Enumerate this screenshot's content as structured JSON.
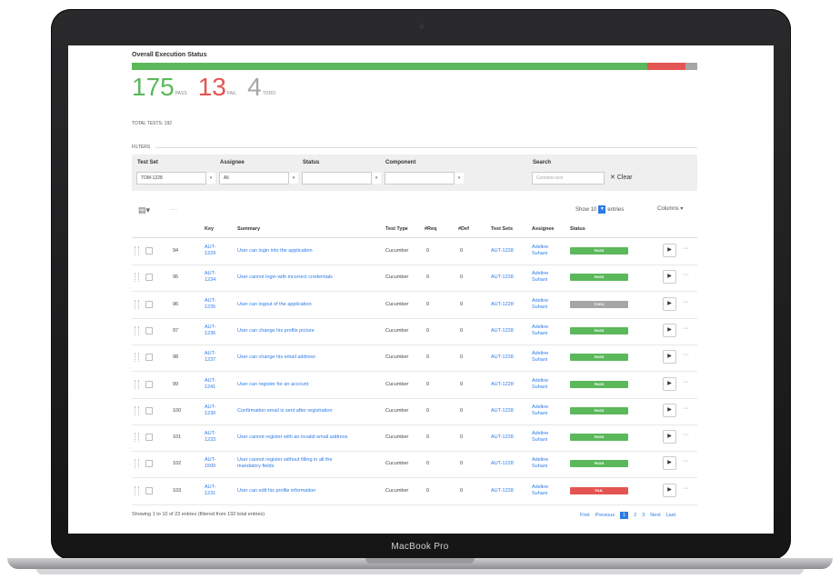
{
  "device": {
    "brand": "MacBook Pro"
  },
  "colors": {
    "pass": "#5bb85b",
    "fail": "#e35552",
    "todo": "#a6a6a6",
    "link": "#2d7be5"
  },
  "execution": {
    "title": "Overall Execution Status",
    "progress": {
      "pass": 175,
      "fail": 13,
      "todo": 4
    },
    "pass_count": "175",
    "pass_label": "PASS",
    "fail_count": "13",
    "fail_label": "FAIL",
    "todo_count": "4",
    "todo_label": "TODO",
    "total": "TOTAL TESTS: 192"
  },
  "filters": {
    "label": "FILTERS",
    "test_set": {
      "label": "Test Set",
      "value": "TOM-1228"
    },
    "assignee": {
      "label": "Assignee",
      "value": "All"
    },
    "status": {
      "label": "Status",
      "value": ""
    },
    "component": {
      "label": "Component",
      "value": ""
    },
    "search": {
      "label": "Search",
      "placeholder": "Contains text"
    },
    "clear_label": "✕ Clear"
  },
  "toolbar": {
    "show_label": "Show",
    "show_value": "10",
    "entries_label": "entries",
    "columns_label": "Columns ▾"
  },
  "table": {
    "headers": [
      "Key",
      "Summary",
      "Test Type",
      "#Req",
      "#Def",
      "Test Sets",
      "Assignee",
      "Status"
    ],
    "rows": [
      {
        "num": "94",
        "key1": "AUT-",
        "key2": "1229",
        "summary1": "User can login into the application",
        "summary2": "",
        "type": "Cucumber",
        "req": "0",
        "def": "0",
        "set": "AUT-1228",
        "a1": "Adeline",
        "a2": "Suhani",
        "status": "PASS"
      },
      {
        "num": "95",
        "key1": "AUT-",
        "key2": "1234",
        "summary1": "User cannot login with incorrect credentials",
        "summary2": "",
        "type": "Cucumber",
        "req": "0",
        "def": "0",
        "set": "AUT-1228",
        "a1": "Adeline",
        "a2": "Suhani",
        "status": "PASS"
      },
      {
        "num": "96",
        "key1": "AUT-",
        "key2": "1235",
        "summary1": "User can logout of the application",
        "summary2": "",
        "type": "Cucumber",
        "req": "0",
        "def": "0",
        "set": "AUT-1228",
        "a1": "Adeline",
        "a2": "Suhani",
        "status": "TODO"
      },
      {
        "num": "97",
        "key1": "AUT-",
        "key2": "1236",
        "summary1": "User can change his profile picture",
        "summary2": "",
        "type": "Cucumber",
        "req": "0",
        "def": "0",
        "set": "AUT-1228",
        "a1": "Adeline",
        "a2": "Suhani",
        "status": "PASS"
      },
      {
        "num": "98",
        "key1": "AUT-",
        "key2": "1237",
        "summary1": "User can change his email address",
        "summary2": "",
        "type": "Cucumber",
        "req": "0",
        "def": "0",
        "set": "AUT-1228",
        "a1": "Adeline",
        "a2": "Suhani",
        "status": "PASS"
      },
      {
        "num": "99",
        "key1": "AUT-",
        "key2": "1241",
        "summary1": "User can register for an account",
        "summary2": "",
        "type": "Cucumber",
        "req": "0",
        "def": "0",
        "set": "AUT-1228",
        "a1": "Adeline",
        "a2": "Suhani",
        "status": "PASS"
      },
      {
        "num": "100",
        "key1": "AUT-",
        "key2": "1230",
        "summary1": "Confirmation email is sent after registration",
        "summary2": "",
        "type": "Cucumber",
        "req": "0",
        "def": "0",
        "set": "AUT-1228",
        "a1": "Adeline",
        "a2": "Suhani",
        "status": "PASS"
      },
      {
        "num": "101",
        "key1": "AUT-",
        "key2": "1233",
        "summary1": "User cannot register with an invalid email address",
        "summary2": "",
        "type": "Cucumber",
        "req": "0",
        "def": "0",
        "set": "AUT-1228",
        "a1": "Adeline",
        "a2": "Suhani",
        "status": "PASS"
      },
      {
        "num": "102",
        "key1": "AUT-",
        "key2": "1500",
        "summary1": "User cannot register without filling in all the",
        "summary2": "mandatory fields",
        "type": "Cucumber",
        "req": "0",
        "def": "0",
        "set": "AUT-1228",
        "a1": "Adeline",
        "a2": "Suhani",
        "status": "PASS"
      },
      {
        "num": "103",
        "key1": "AUT-",
        "key2": "1231",
        "summary1": "User can edit his profile information",
        "summary2": "",
        "type": "Cucumber",
        "req": "0",
        "def": "0",
        "set": "AUT-1228",
        "a1": "Adeline",
        "a2": "Suhani",
        "status": "FAIL"
      }
    ]
  },
  "footer": {
    "info": "Showing 1 to 10 of 23 entries (filtered from 192 total entries)",
    "first": "First",
    "previous": "Previous",
    "pages": [
      "1",
      "2",
      "3"
    ],
    "next": "Next",
    "last": "Last"
  }
}
